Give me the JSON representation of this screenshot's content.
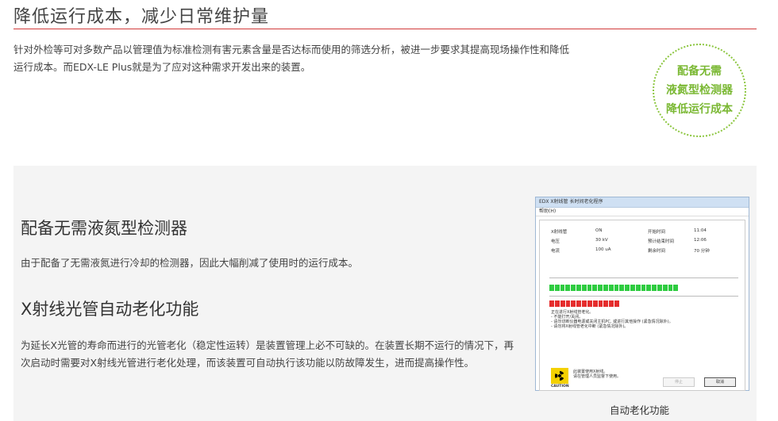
{
  "header": {
    "title": "降低运行成本，减少日常维护量"
  },
  "intro": {
    "line1": "针对外检等可对多数产品以管理值为标准检测有害元素含量是否达标而使用的筛选分析，被进一步要求其提高现场操作性和降低",
    "line2": "运行成本。而EDX-LE Plus就是为了应对这种需求开发出来的装置。"
  },
  "badge": {
    "line1": "配备无需",
    "line2": "液氮型检测器",
    "line3": "降低运行成本"
  },
  "section1": {
    "title": "配备无需液氮型检测器",
    "body": "由于配备了无需液氮进行冷却的检测器，因此大幅削减了使用时的运行成本。"
  },
  "section2": {
    "title": "X射线光管自动老化功能",
    "body": "为延长X光管的寿命而进行的光管老化（稳定性运转）是装置管理上必不可缺的。在装置长期不运行的情况下，再次启动时需要对X射线光管进行老化处理，而该装置可自动执行该功能以防故障发生，进而提高操作性。"
  },
  "screenshot": {
    "window_title": "EDX X射线管 长时间老化程序",
    "menu": "帮助(H)",
    "rows": [
      {
        "label": "X射线管",
        "value": "ON",
        "label2": "开始时间",
        "value2": "11:04"
      },
      {
        "label": "电压",
        "value": "30 kV",
        "label2": "预计结束时间",
        "value2": "12:06"
      },
      {
        "label": "电流",
        "value": "100 uA",
        "label2": "剩余时间",
        "value2": "70 分钟"
      }
    ],
    "green_progress": 1.0,
    "red_progress": 0.55,
    "notes": [
      "正在进行X射线管老化。",
      "- 不能打开/关闭。",
      "- 请勿切断仪器电源或关闭主机PC, 或进行其他操作 (紧急情况除外)。",
      "- 请勿将X射线管老化中断 (紧急情况除外)。"
    ],
    "warning_line1": "此装置使用X射线。",
    "warning_line2": "请在管理人员监督下使用。",
    "caution_label": "CAUTION",
    "stop_button": "停止",
    "cancel_button": "取消"
  },
  "caption": "自动老化功能",
  "colors": {
    "accent_rule": "#d23a3a",
    "badge_green": "#7ab833",
    "progress_green": "#2ecc40",
    "progress_red": "#e52d2d"
  }
}
